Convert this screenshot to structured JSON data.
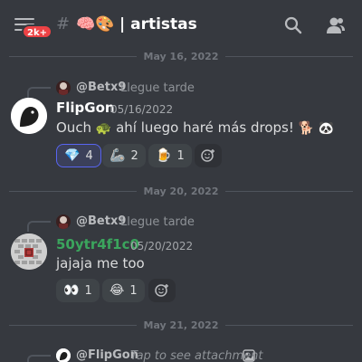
{
  "header": {
    "badge": "2k+",
    "hash": "#",
    "channel_emojis": "🧠🎨",
    "channel_title": "| artistas"
  },
  "dividers": [
    "May 16, 2022",
    "May 20, 2022",
    "May 21, 2022"
  ],
  "messages": [
    {
      "reply": {
        "name": "@Betx9",
        "text": "Llegue tarde"
      },
      "author": "FlipGon",
      "author_color": "#ffffff",
      "timestamp": "05/16/2022",
      "text_a": "Ouch",
      "emoji_a": "🐢",
      "text_b": "ahí luego haré más drops!",
      "emoji_b": "🐕",
      "emoji_c": "🐼",
      "reactions": [
        {
          "emoji": "💎",
          "count": "4",
          "me": true
        },
        {
          "emoji": "🦾",
          "count": "2",
          "me": false
        },
        {
          "emoji": "🍺",
          "count": "1",
          "me": false
        }
      ]
    },
    {
      "reply": {
        "name": "@Betx9",
        "text": "Llegue tarde"
      },
      "author": "50ytr4f1c0",
      "author_color": "#3ba55d",
      "timestamp": "05/20/2022",
      "text": "jajaja me too",
      "reactions": [
        {
          "emoji": "👀",
          "count": "1",
          "me": false
        },
        {
          "emoji": "😂",
          "count": "1",
          "me": false
        }
      ]
    },
    {
      "reply": {
        "name": "@FlipGon",
        "text": "Tap to see attachment"
      }
    }
  ]
}
